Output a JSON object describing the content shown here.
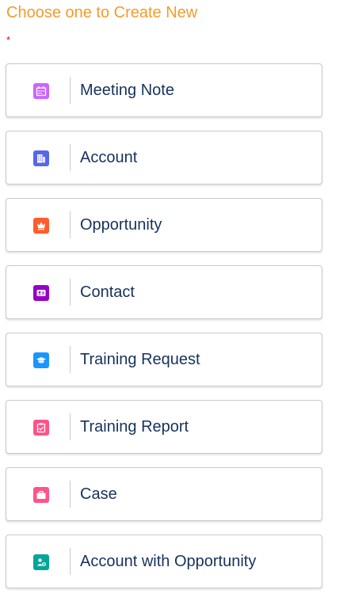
{
  "header": {
    "title": "Choose one to Create New",
    "required_marker": "*"
  },
  "options": [
    {
      "label": "Meeting Note",
      "icon": "calendar-icon",
      "color": "#cb65ff"
    },
    {
      "label": "Account",
      "icon": "account-building-icon",
      "color": "#5867e8"
    },
    {
      "label": "Opportunity",
      "icon": "crown-icon",
      "color": "#ff5d2d"
    },
    {
      "label": "Contact",
      "icon": "contact-card-icon",
      "color": "#a094ed"
    },
    {
      "label": "Training Request",
      "icon": "graduation-cap-icon",
      "color": "#1b96ff"
    },
    {
      "label": "Training Report",
      "icon": "clipboard-icon",
      "color": "#ff538a"
    },
    {
      "label": "Case",
      "icon": "briefcase-icon",
      "color": "#ff538a"
    },
    {
      "label": "Account with Opportunity",
      "icon": "person-link-icon",
      "color": "#06a59a"
    }
  ]
}
